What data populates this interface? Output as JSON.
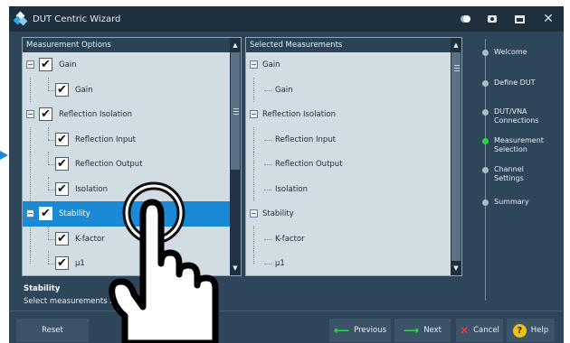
{
  "window": {
    "title": "DUT Centric Wizard",
    "controls": {
      "close": "✕"
    }
  },
  "options_panel": {
    "header": "Measurement Options",
    "rows": [
      {
        "label": "Gain",
        "level": 0,
        "expander": "−",
        "checked": "✔"
      },
      {
        "label": "Gain",
        "level": 1,
        "checked": "✔"
      },
      {
        "label": "Reflection Isolation",
        "level": 0,
        "expander": "−",
        "checked": "✔"
      },
      {
        "label": "Reflection Input",
        "level": 1,
        "checked": "✔"
      },
      {
        "label": "Reflection Output",
        "level": 1,
        "checked": "✔"
      },
      {
        "label": "Isolation",
        "level": 1,
        "checked": "✔"
      },
      {
        "label": "Stability",
        "level": 0,
        "expander": "−",
        "checked": "✔",
        "selected": true
      },
      {
        "label": "K-factor",
        "level": 1,
        "checked": "✔"
      },
      {
        "label": "μ1",
        "level": 1,
        "checked": "✔"
      }
    ],
    "scroll_up": "▲",
    "scroll_down": "▼"
  },
  "selected_panel": {
    "header": "Selected Measurements",
    "rows": [
      {
        "label": "Gain",
        "level": 0,
        "expander": "−"
      },
      {
        "label": "Gain",
        "level": 1
      },
      {
        "label": "Reflection Isolation",
        "level": 0,
        "expander": "−"
      },
      {
        "label": "Reflection Input",
        "level": 1
      },
      {
        "label": "Reflection Output",
        "level": 1
      },
      {
        "label": "Isolation",
        "level": 1
      },
      {
        "label": "Stability",
        "level": 0,
        "expander": "−"
      },
      {
        "label": "K-factor",
        "level": 1
      },
      {
        "label": "μ1",
        "level": 1
      }
    ],
    "scroll_up": "▲",
    "scroll_down": "▼"
  },
  "status": {
    "title": "Stability",
    "text": "Select measurements for m"
  },
  "steps": [
    {
      "label": "Welcome",
      "active": false
    },
    {
      "label": "Define DUT",
      "active": false
    },
    {
      "label": "DUT/VNA\nConnections",
      "active": false
    },
    {
      "label": "Measurement\nSelection",
      "active": true
    },
    {
      "label": "Channel\nSettings",
      "active": false
    },
    {
      "label": "Summary",
      "active": false
    }
  ],
  "buttons": {
    "reset": "Reset",
    "previous": "Previous",
    "previous_icon": "⟵",
    "next": "Next",
    "next_icon": "⟶",
    "cancel": "Cancel",
    "cancel_icon": "✕",
    "help": "Help",
    "help_icon": "?"
  },
  "colors": {
    "accent": "#1a8ad6",
    "active_step": "#27d63a",
    "panel_bg": "#d1dde3",
    "window_bg": "#2f4559"
  }
}
